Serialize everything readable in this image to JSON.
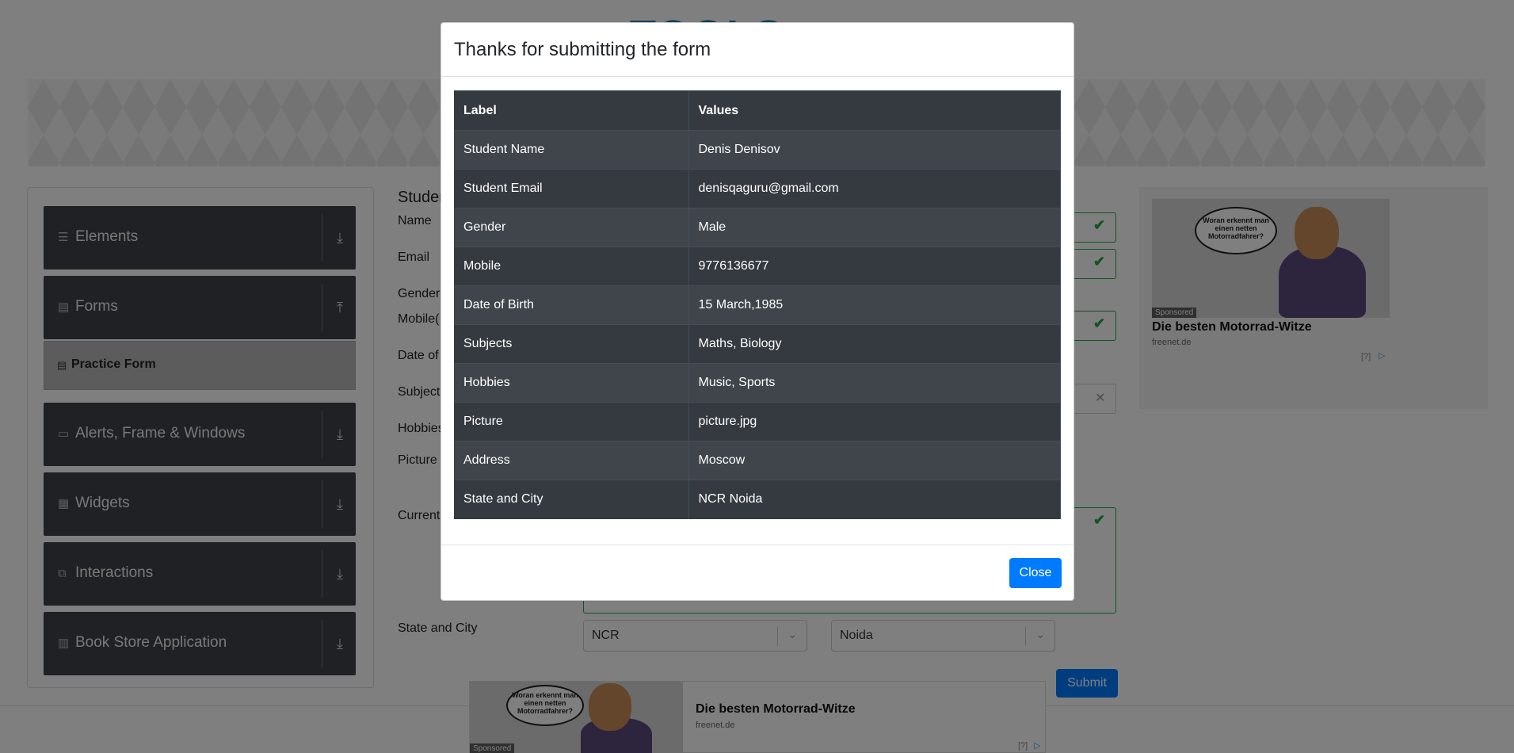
{
  "site": {
    "logo_text": "TOOLS"
  },
  "sidebar": {
    "groups": [
      {
        "label": "Elements",
        "icon": "list-icon"
      },
      {
        "label": "Forms",
        "icon": "document-icon"
      },
      {
        "label": "Alerts, Frame & Windows",
        "icon": "window-icon"
      },
      {
        "label": "Widgets",
        "icon": "widgets-icon"
      },
      {
        "label": "Interactions",
        "icon": "interactions-icon"
      },
      {
        "label": "Book Store Application",
        "icon": "books-icon"
      }
    ],
    "active_item": "Practice Form"
  },
  "form": {
    "title": "Studen",
    "labels": {
      "name": "Name",
      "email": "Email",
      "gender": "Gender",
      "mobile": "Mobile(",
      "dob": "Date of",
      "subjects": "Subject",
      "hobbies": "Hobbies",
      "picture": "Picture",
      "address": "Current",
      "state_city": "State and City"
    },
    "state_value": "NCR",
    "city_value": "Noida",
    "submit_label": "Submit"
  },
  "ads": {
    "bubble_text": "Woran erkennt man einen netten Motorradfahrer?",
    "sponsored": "Sponsored",
    "title": "Die besten Motorrad-Witze",
    "host": "freenet.de",
    "info": "[?]"
  },
  "modal": {
    "title": "Thanks for submitting the form",
    "columns": [
      "Label",
      "Values"
    ],
    "rows": [
      {
        "label": "Student Name",
        "value": "Denis Denisov"
      },
      {
        "label": "Student Email",
        "value": "denisqaguru@gmail.com"
      },
      {
        "label": "Gender",
        "value": "Male"
      },
      {
        "label": "Mobile",
        "value": "9776136677"
      },
      {
        "label": "Date of Birth",
        "value": "15 March,1985"
      },
      {
        "label": "Subjects",
        "value": "Maths, Biology"
      },
      {
        "label": "Hobbies",
        "value": "Music, Sports"
      },
      {
        "label": "Picture",
        "value": "picture.jpg"
      },
      {
        "label": "Address",
        "value": "Moscow"
      },
      {
        "label": "State and City",
        "value": "NCR Noida"
      }
    ],
    "close_label": "Close"
  }
}
